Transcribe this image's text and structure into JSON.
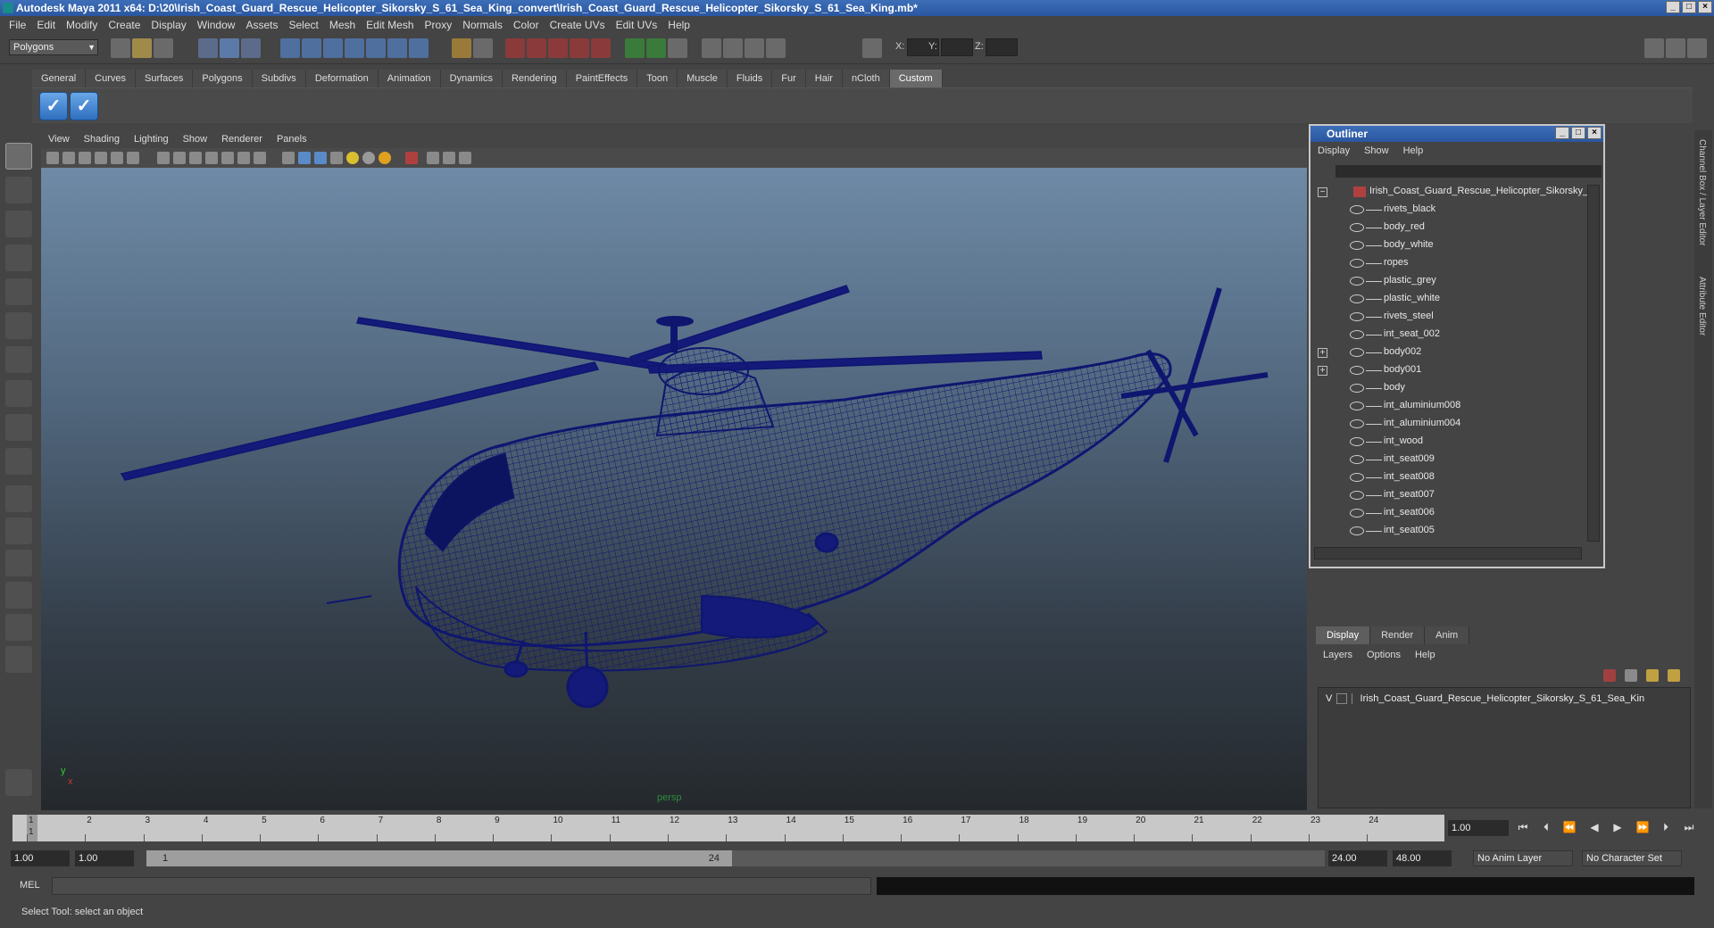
{
  "window": {
    "title": "Autodesk Maya 2011 x64: D:\\20\\Irish_Coast_Guard_Rescue_Helicopter_Sikorsky_S_61_Sea_King_convert\\Irish_Coast_Guard_Rescue_Helicopter_Sikorsky_S_61_Sea_King.mb*"
  },
  "menubar": [
    "File",
    "Edit",
    "Modify",
    "Create",
    "Display",
    "Window",
    "Assets",
    "Select",
    "Mesh",
    "Edit Mesh",
    "Proxy",
    "Normals",
    "Color",
    "Create UVs",
    "Edit UVs",
    "Help"
  ],
  "statusline": {
    "mode": "Polygons",
    "x_label": "X:",
    "y_label": "Y:",
    "z_label": "Z:"
  },
  "shelf": {
    "tabs": [
      "General",
      "Curves",
      "Surfaces",
      "Polygons",
      "Subdivs",
      "Deformation",
      "Animation",
      "Dynamics",
      "Rendering",
      "PaintEffects",
      "Toon",
      "Muscle",
      "Fluids",
      "Fur",
      "Hair",
      "nCloth",
      "Custom"
    ],
    "active_tab": "Custom"
  },
  "viewport": {
    "menu": [
      "View",
      "Shading",
      "Lighting",
      "Show",
      "Renderer",
      "Panels"
    ],
    "camera_label": "persp",
    "axis_y": "y",
    "axis_x": "x",
    "wireframe_color": "#0f1670"
  },
  "outliner": {
    "title": "Outliner",
    "menu": [
      "Display",
      "Show",
      "Help"
    ],
    "root": "Irish_Coast_Guard_Rescue_Helicopter_Sikorsky_",
    "items": [
      {
        "label": "rivets_black",
        "expandable": false
      },
      {
        "label": "body_red",
        "expandable": false
      },
      {
        "label": "body_white",
        "expandable": false
      },
      {
        "label": "ropes",
        "expandable": false
      },
      {
        "label": "plastic_grey",
        "expandable": false
      },
      {
        "label": "plastic_white",
        "expandable": false
      },
      {
        "label": "rivets_steel",
        "expandable": false
      },
      {
        "label": "int_seat_002",
        "expandable": false
      },
      {
        "label": "body002",
        "expandable": true
      },
      {
        "label": "body001",
        "expandable": true
      },
      {
        "label": "body",
        "expandable": false
      },
      {
        "label": "int_aluminium008",
        "expandable": false
      },
      {
        "label": "int_aluminium004",
        "expandable": false
      },
      {
        "label": "int_wood",
        "expandable": false
      },
      {
        "label": "int_seat009",
        "expandable": false
      },
      {
        "label": "int_seat008",
        "expandable": false
      },
      {
        "label": "int_seat007",
        "expandable": false
      },
      {
        "label": "int_seat006",
        "expandable": false
      },
      {
        "label": "int_seat005",
        "expandable": false
      }
    ]
  },
  "side_tabs": [
    "Channel Box / Layer Editor",
    "Attribute Editor"
  ],
  "layer_editor": {
    "tabs": [
      "Display",
      "Render",
      "Anim"
    ],
    "active_tab": "Display",
    "menu": [
      "Layers",
      "Options",
      "Help"
    ],
    "layer_visible": "V",
    "layer_name": "Irish_Coast_Guard_Rescue_Helicopter_Sikorsky_S_61_Sea_Kin"
  },
  "timeline": {
    "ticks": [
      "1",
      "2",
      "3",
      "4",
      "5",
      "6",
      "7",
      "8",
      "9",
      "10",
      "11",
      "12",
      "13",
      "14",
      "15",
      "16",
      "17",
      "18",
      "19",
      "20",
      "21",
      "22",
      "23",
      "24"
    ],
    "current_marker": "1",
    "current_frame": "1.00"
  },
  "range": {
    "start": "1.00",
    "playback_start": "1.00",
    "thumb_start": "1",
    "thumb_end": "24",
    "playback_end": "24.00",
    "end": "48.00",
    "anim_layer": "No Anim Layer",
    "character_set": "No Character Set"
  },
  "command_line": {
    "label": "MEL"
  },
  "help_line": "Select Tool: select an object"
}
